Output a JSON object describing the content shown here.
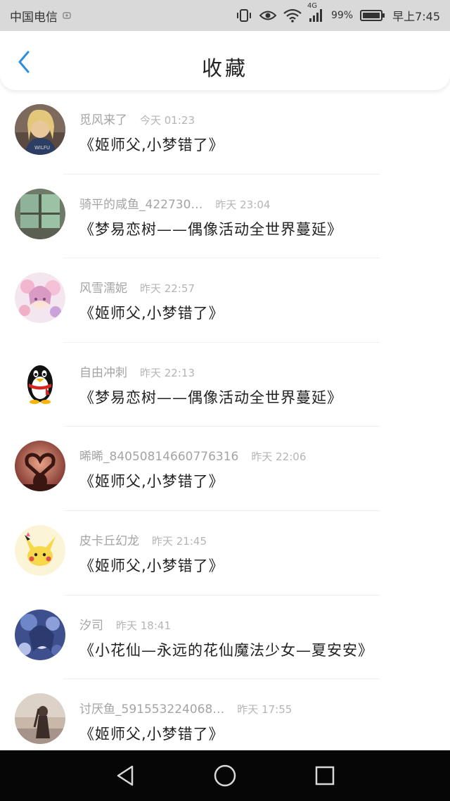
{
  "status_bar": {
    "carrier": "中国电信",
    "network": "4G",
    "battery": "99%",
    "time": "早上7:45"
  },
  "header": {
    "title": "收藏"
  },
  "favorites": [
    {
      "author": "觅风来了",
      "time": "今天 01:23",
      "content": "《姬师父,小梦错了》",
      "avatar": "avatar-girl-photo"
    },
    {
      "author": "骑平的咸鱼_422730…",
      "time": "昨天 23:04",
      "content": "《梦易恋树——偶像活动全世界蔓延》",
      "avatar": "avatar-room-photo"
    },
    {
      "author": "风雪濡妮",
      "time": "昨天 22:57",
      "content": "《姬师父,小梦错了》",
      "avatar": "avatar-anime-pink"
    },
    {
      "author": "自由冲刺",
      "time": "昨天 22:13",
      "content": "《梦易恋树——偶像活动全世界蔓延》",
      "avatar": "avatar-qq-penguin"
    },
    {
      "author": "晞晞_84050814660776316",
      "time": "昨天 22:06",
      "content": "《姬师父,小梦错了》",
      "avatar": "avatar-heart-sunset"
    },
    {
      "author": "皮卡丘幻龙",
      "time": "昨天 21:45",
      "content": "《姬师父,小梦错了》",
      "avatar": "avatar-pikachu"
    },
    {
      "author": "汐司",
      "time": "昨天 18:41",
      "content": "《小花仙—永远的花仙魔法少女—夏安安》",
      "avatar": "avatar-anime-blue"
    },
    {
      "author": "讨厌鱼_591553224068…",
      "time": "昨天 17:55",
      "content": "《姬师父,小梦错了》",
      "avatar": "avatar-beach-girl"
    }
  ],
  "colors": {
    "accent": "#2a8fe0",
    "status_bar_bg": "#d9d9d9",
    "nav_bar_bg": "#060606"
  }
}
